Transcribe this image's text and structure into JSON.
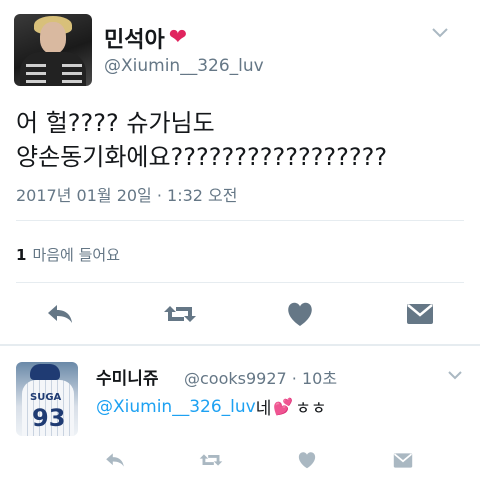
{
  "tweet": {
    "display_name": "민석아",
    "name_emoji": "heart-emoji",
    "handle": "@Xiumin__326_luv",
    "text_line1": "어 헐???? 슈가님도",
    "text_line2": "양손동기화에요?????????????????",
    "timestamp": "2017년 01월 20일 · 1:32 오전",
    "likes_count": "1",
    "likes_label": "마음에 들어요",
    "actions": [
      "reply-icon",
      "retweet-icon",
      "like-icon",
      "message-icon"
    ]
  },
  "reply": {
    "display_name": "수미니쥬",
    "handle_time": "@cooks9927 · 10초",
    "mention": "@Xiumin__326_luv",
    "text_before_emoji": " 네",
    "text_after_emoji": "ㅎㅎ",
    "avatar_jersey_name": "SUGA",
    "avatar_jersey_number": "93",
    "actions": [
      "reply-icon",
      "retweet-icon",
      "like-icon",
      "message-icon"
    ]
  },
  "colors": {
    "text": "#14171a",
    "secondary": "#657786",
    "icon": "#657786",
    "link": "#1da1f2",
    "heart": "#e0245e",
    "divider": "#e6ecf0"
  }
}
